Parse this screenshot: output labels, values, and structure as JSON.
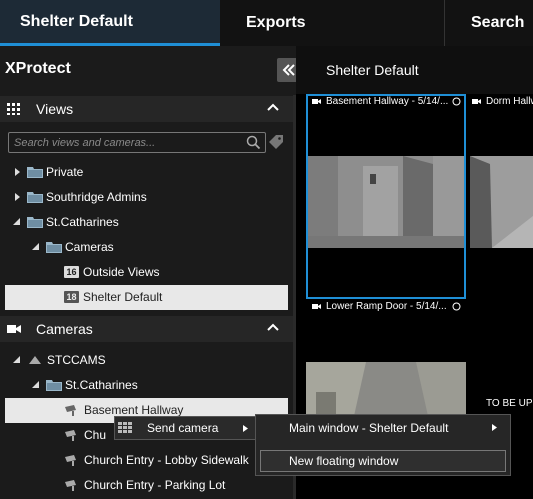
{
  "tabs": [
    {
      "label": "Shelter Default"
    },
    {
      "label": "Exports"
    },
    {
      "label": "Search"
    }
  ],
  "app_title": "XProtect",
  "views_section": {
    "title": "Views",
    "search_placeholder": "Search views and cameras...",
    "items": [
      {
        "label": "Private"
      },
      {
        "label": "Southridge Admins"
      },
      {
        "label": "St.Catharines"
      },
      {
        "label": "Cameras"
      },
      {
        "label": "Outside Views",
        "badge": "16"
      },
      {
        "label": "Shelter Default",
        "badge": "18"
      }
    ]
  },
  "cameras_section": {
    "title": "Cameras",
    "items": [
      {
        "label": "STCCAMS"
      },
      {
        "label": "St.Catharines"
      },
      {
        "label": "Basement Hallway"
      },
      {
        "label": "Chu"
      },
      {
        "label": "Church Entry - Lobby Sidewalk"
      },
      {
        "label": "Church Entry - Parking Lot"
      }
    ]
  },
  "view_title": "Shelter Default",
  "tiles": [
    {
      "label": "Basement Hallway - 5/14/..."
    },
    {
      "label": "Dorm Hallw"
    },
    {
      "label": "Lower Ramp Door - 5/14/..."
    }
  ],
  "tile_overlay_text": "TO BE UP",
  "context_menu": {
    "send_camera": "Send camera",
    "main_window": "Main window - Shelter Default",
    "new_floating": "New floating window"
  },
  "colors": {
    "accent": "#1f8fd6",
    "selection": "#e8e8e8",
    "panel": "#1b1b1b"
  }
}
